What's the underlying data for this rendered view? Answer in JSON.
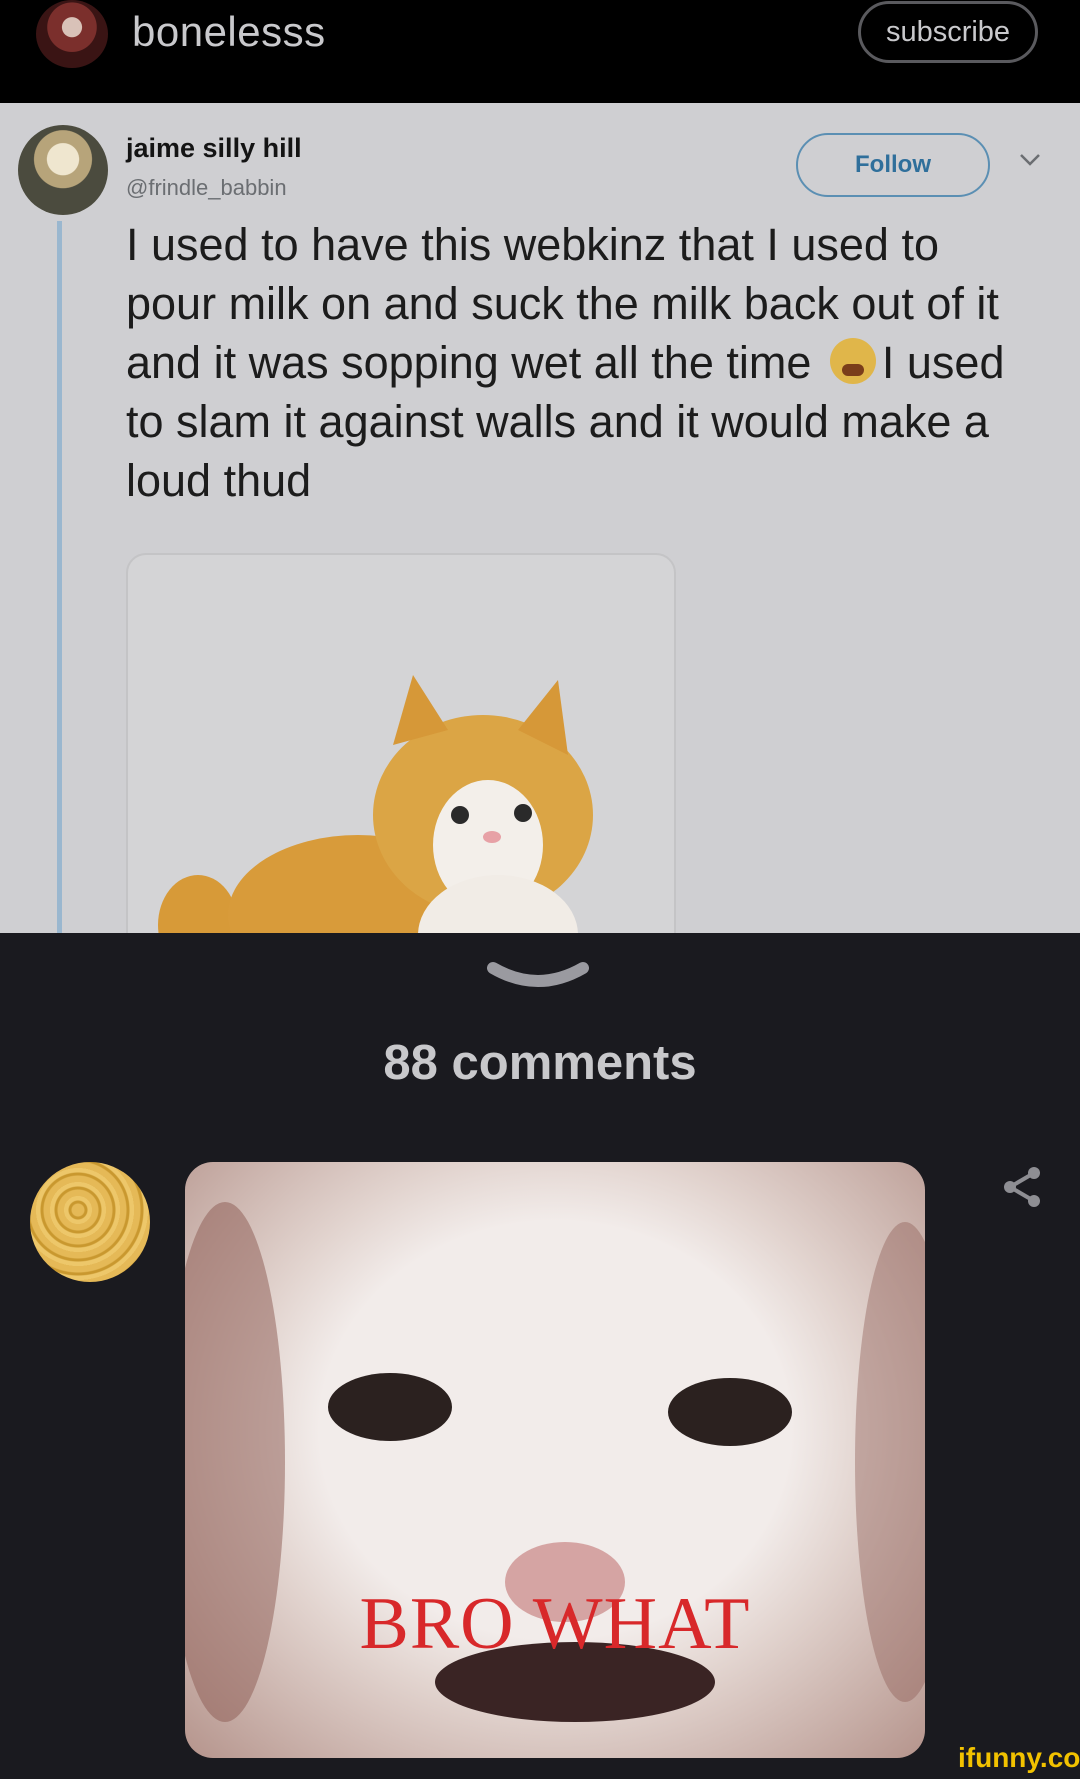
{
  "header": {
    "username": "bonelesss",
    "subscribe_label": "subscribe"
  },
  "tweet": {
    "display_name": "jaime silly hill",
    "handle": "@frindle_babbin",
    "follow_label": "Follow",
    "text_before_emoji": "I used to have this webkinz that I used to pour milk on and suck the milk back out of it and it was sopping wet all the time",
    "text_after_emoji": "I used to slam it against walls and it would make a loud thud"
  },
  "comments": {
    "count_label": "88 comments"
  },
  "comment": {
    "image_caption": "BRO WHAT"
  },
  "watermark": "ifunny.co",
  "colors": {
    "accent_follow": "#2f6f9b",
    "watermark": "#f2c200",
    "caption_red": "#d8282a"
  },
  "icons": [
    "subscribe-button",
    "chevron-down-icon",
    "crying-face-emoji",
    "swipe-chevron-icon",
    "share-icon"
  ]
}
